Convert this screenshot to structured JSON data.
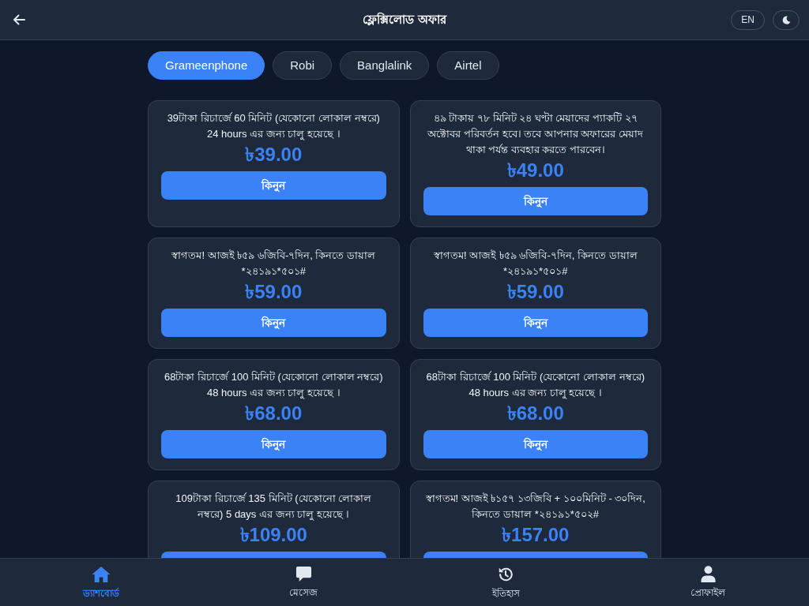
{
  "header": {
    "title": "ফ্লেক্সিলোড অফার",
    "language_button": "EN"
  },
  "operator_tabs": [
    {
      "label": "Grameenphone",
      "selected": true
    },
    {
      "label": "Robi",
      "selected": false
    },
    {
      "label": "Banglalink",
      "selected": false
    },
    {
      "label": "Airtel",
      "selected": false
    }
  ],
  "offers": [
    {
      "description": "39টাকা রিচার্জে 60 মিনিট (যেকোনো লোকাল নম্বরে) 24 hours এর জন্য চালু হয়েছে ।",
      "price": "৳39.00",
      "buy_label": "কিনুন"
    },
    {
      "description": "৪৯ টাকায় ৭৮ মিনিট ২৪ ঘণ্টা মেয়াদের প্যাকটি ২৭ অক্টোবর পরিবর্তন হবে। তবে আপনার অফারের মেয়াদ থাকা পর্যন্ত ব্যবহার করতে পারবেন।",
      "price": "৳49.00",
      "buy_label": "কিনুন"
    },
    {
      "description": "স্বাগতম! আজই ৳৫৯ ৬জিবি-৭দিন, কিনতে ডায়াল *২৪১৯১*৫০১#",
      "price": "৳59.00",
      "buy_label": "কিনুন"
    },
    {
      "description": "স্বাগতম! আজই ৳৫৯ ৬জিবি-৭দিন, কিনতে ডায়াল *২৪১৯১*৫০১#",
      "price": "৳59.00",
      "buy_label": "কিনুন"
    },
    {
      "description": "68টাকা রিচার্জে 100 মিনিট (যেকোনো লোকাল নম্বরে) 48 hours এর জন্য চালু হয়েছে ।",
      "price": "৳68.00",
      "buy_label": "কিনুন"
    },
    {
      "description": "68টাকা রিচার্জে 100 মিনিট (যেকোনো লোকাল নম্বরে) 48 hours এর জন্য চালু হয়েছে ।",
      "price": "৳68.00",
      "buy_label": "কিনুন"
    },
    {
      "description": "109টাকা রিচার্জে 135 মিনিট (যেকোনো লোকাল নম্বরে) 5 days এর জন্য চালু হয়েছে ।",
      "price": "৳109.00"
    },
    {
      "description": "স্বাগতম! আজই ৳১৫৭ ১৩জিবি + ১০০মিনিট - ৩০দিন, কিনতে ডায়াল *২৪১৯১*৫০২#",
      "price": "৳157.00"
    }
  ],
  "bottom_nav": [
    {
      "kind": "home",
      "label": "ড্যাশবোর্ড",
      "selected": true
    },
    {
      "kind": "message",
      "label": "মেসেজ",
      "selected": false
    },
    {
      "kind": "history",
      "label": "ইতিহাস",
      "selected": false
    },
    {
      "kind": "profile",
      "label": "প্রোফাইল",
      "selected": false
    }
  ]
}
